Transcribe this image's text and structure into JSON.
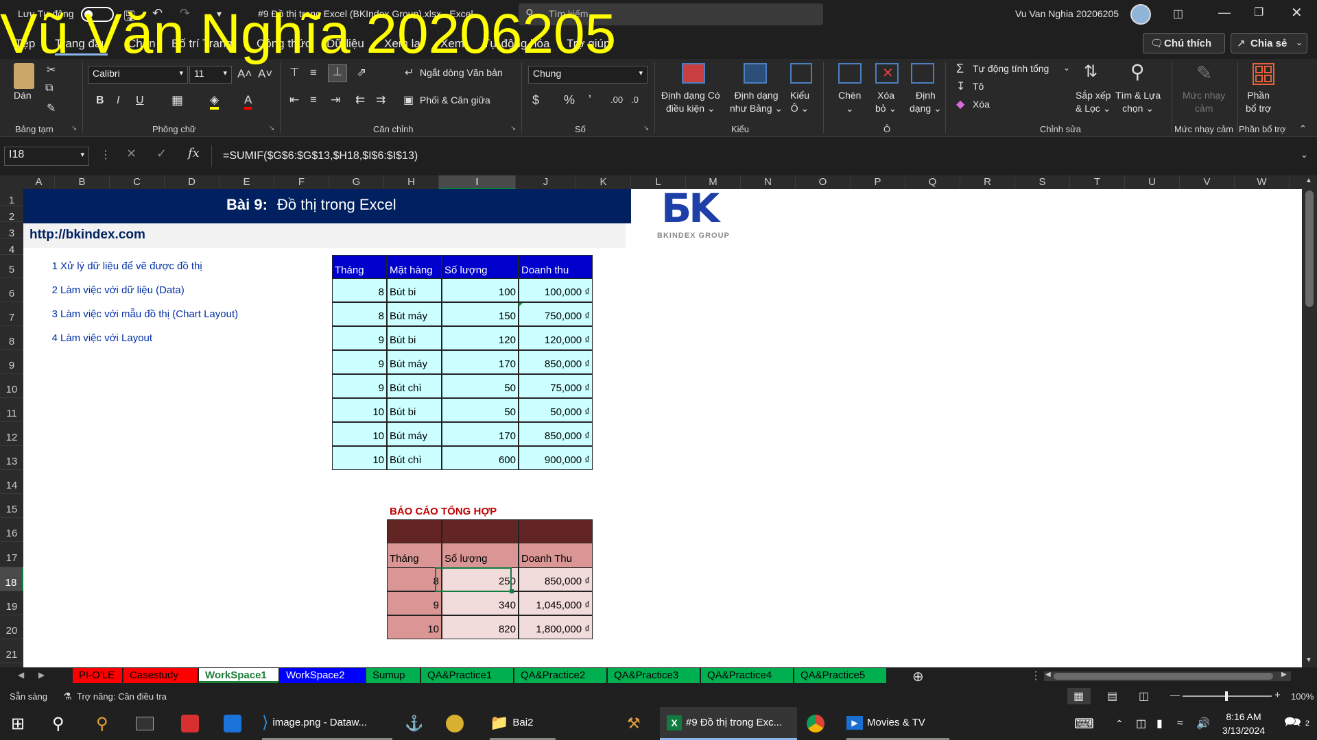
{
  "titlebar": {
    "autosave_label": "Lưu Tự động",
    "filename": "#9 Đồ thị trong Excel (BKIndex Group).xlsx  -  Excel",
    "search_placeholder": "Tìm kiếm",
    "user": "Vu Van Nghia 20206205"
  },
  "watermark": "Vũ Văn Nghĩa 20206205",
  "ribbon_tabs": [
    "Tệp",
    "Trang đầu",
    "Chèn",
    "Bố trí Trang",
    "Công thức",
    "Dữ liệu",
    "Xem lại",
    "Xem",
    "Tự động hóa",
    "Trợ giúp"
  ],
  "ribbon_buttons": {
    "comment": "Chú thích",
    "share": "Chia sẻ"
  },
  "ribbon": {
    "paste": "Dán",
    "clipboard_group": "Bảng tạm",
    "font_name": "Calibri",
    "font_size": "11",
    "font_group": "Phông chữ",
    "wrap_text": "Ngắt dòng Văn bản",
    "merge_center": "Phối & Căn giữa",
    "alignment_group": "Căn chỉnh",
    "number_format": "Chung",
    "number_group": "Số",
    "cond_format_l1": "Định dạng Có",
    "cond_format_l2": "điều kiện",
    "format_table_l1": "Định dạng",
    "format_table_l2": "như Bảng",
    "cell_styles_l1": "Kiểu",
    "cell_styles_l2": "Ô",
    "styles_group": "Kiểu",
    "insert": "Chèn",
    "delete_l1": "Xóa",
    "delete_l2": "bỏ",
    "format_l1": "Định",
    "format_l2": "dạng",
    "cells_group": "Ô",
    "autosum": "Tự động tính tổng",
    "fill": "Tô",
    "clear": "Xóa",
    "sort_l1": "Sắp xếp",
    "sort_l2": "& Lọc",
    "find_l1": "Tìm & Lựa",
    "find_l2": "chọn",
    "editing_group": "Chỉnh sửa",
    "sensitivity_l1": "Mức nhạy",
    "sensitivity_l2": "cảm",
    "sensitivity_group": "Mức nhạy cảm",
    "addins_l1": "Phần",
    "addins_l2": "bổ trợ",
    "addins_group": "Phần bổ trợ"
  },
  "formula_bar": {
    "name_box": "I18",
    "formula": "=SUMIF($G$6:$G$13,$H18,$I$6:$I$13)"
  },
  "columns": [
    "A",
    "B",
    "C",
    "D",
    "E",
    "F",
    "G",
    "H",
    "I",
    "J",
    "K",
    "L",
    "M",
    "N",
    "O",
    "P",
    "Q",
    "R",
    "S",
    "T",
    "U",
    "V",
    "W"
  ],
  "rows": [
    "1",
    "2",
    "3",
    "4",
    "5",
    "6",
    "7",
    "8",
    "9",
    "10",
    "11",
    "12",
    "13",
    "14",
    "15",
    "16",
    "17",
    "18",
    "19",
    "20",
    "21"
  ],
  "sheet": {
    "title_bold": "Bài 9:",
    "title_rest": "Đồ thị trong Excel",
    "link": "http://bkindex.com",
    "logo_text": "BKINDEX GROUP",
    "toc": [
      {
        "n": "1",
        "text": "Xử lý dữ liệu để vẽ được đồ thị"
      },
      {
        "n": "2",
        "text": "Làm việc với dữ liệu (Data)"
      },
      {
        "n": "3",
        "text": "Làm việc với mẫu đồ thị (Chart Layout)"
      },
      {
        "n": "4",
        "text": "Làm việc với Layout"
      }
    ],
    "data_table": {
      "headers": [
        "Tháng",
        "Mặt hàng",
        "Số lượng",
        "Doanh thu"
      ],
      "rows": [
        [
          "8",
          "Bút bi",
          "100",
          "100,000 ₫"
        ],
        [
          "8",
          "Bút máy",
          "150",
          "750,000 ₫"
        ],
        [
          "9",
          "Bút bi",
          "120",
          "120,000 ₫"
        ],
        [
          "9",
          "Bút máy",
          "170",
          "850,000 ₫"
        ],
        [
          "9",
          "Bút chì",
          "50",
          "75,000 ₫"
        ],
        [
          "10",
          "Bút bi",
          "50",
          "50,000 ₫"
        ],
        [
          "10",
          "Bút máy",
          "170",
          "850,000 ₫"
        ],
        [
          "10",
          "Bút chì",
          "600",
          "900,000 ₫"
        ]
      ]
    },
    "report": {
      "title": "BÁO CÁO TỔNG HỢP",
      "headers": [
        "Tháng",
        "Số lượng",
        "Doanh Thu"
      ],
      "rows": [
        [
          "8",
          "250",
          "850,000 ₫"
        ],
        [
          "9",
          "340",
          "1,045,000 ₫"
        ],
        [
          "10",
          "820",
          "1,800,000 ₫"
        ]
      ]
    }
  },
  "sheet_tabs": [
    {
      "name": "PI-O'LE",
      "color": "#ff0000"
    },
    {
      "name": "Casestudy",
      "color": "#ff0000"
    },
    {
      "name": "WorkSpace1",
      "color": "#ffffff"
    },
    {
      "name": "WorkSpace2",
      "color": "#0000ff"
    },
    {
      "name": "Sumup",
      "color": "#00b050"
    },
    {
      "name": "QA&Practice1",
      "color": "#00b050"
    },
    {
      "name": "QA&Practice2",
      "color": "#00b050"
    },
    {
      "name": "QA&Practice3",
      "color": "#00b050"
    },
    {
      "name": "QA&Practice4",
      "color": "#00b050"
    },
    {
      "name": "QA&Practice5",
      "color": "#00b050"
    }
  ],
  "status": {
    "ready": "Sẵn sàng",
    "accessibility": "Trợ năng: Cần điều tra",
    "zoom": "100%"
  },
  "taskbar": {
    "vscode": "image.png - Dataw...",
    "folder": "Bai2",
    "excel": "#9 Đồ thị trong Exc...",
    "movies": "Movies & TV",
    "time": "8:16 AM",
    "date": "3/13/2024",
    "notif": "2"
  }
}
